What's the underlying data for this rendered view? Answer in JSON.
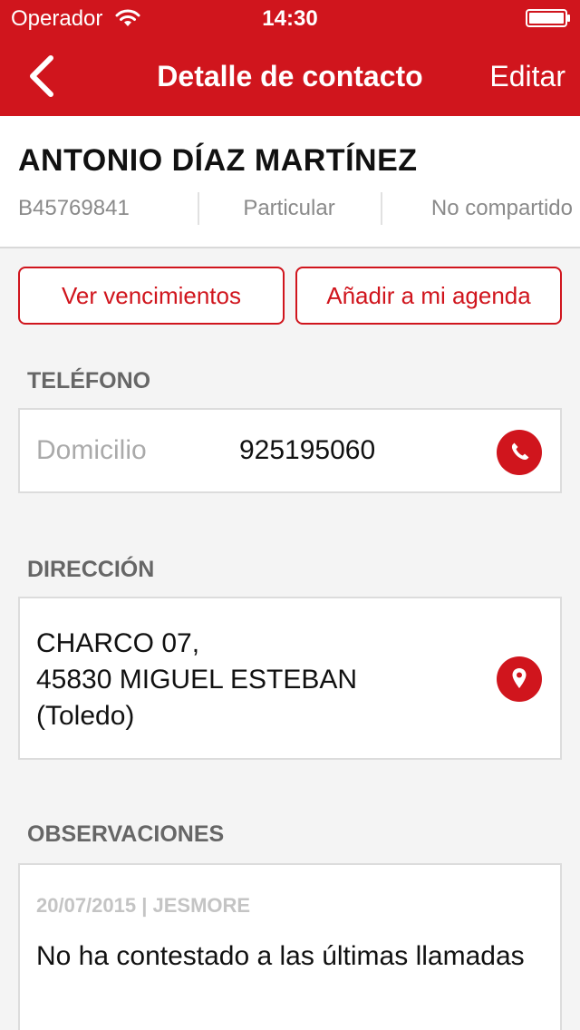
{
  "status_bar": {
    "carrier": "Operador",
    "time": "14:30"
  },
  "nav": {
    "title": "Detalle de contacto",
    "edit_label": "Editar"
  },
  "contact": {
    "name": "ANTONIO DÍAZ MARTÍNEZ",
    "id": "B45769841",
    "type": "Particular",
    "sharing": "No compartido"
  },
  "actions": {
    "vencimientos_label": "Ver vencimientos",
    "agenda_label": "Añadir a mi agenda"
  },
  "phone": {
    "section_title": "TELÉFONO",
    "type": "Domicilio",
    "number": "925195060"
  },
  "address": {
    "section_title": "DIRECCIÓN",
    "line1": "CHARCO 07,",
    "line2": "45830 MIGUEL ESTEBAN",
    "line3": "(Toledo)"
  },
  "observations": {
    "section_title": "OBSERVACIONES",
    "meta": "20/07/2015 | JESMORE",
    "text": "No ha contestado a las últimas llamadas"
  },
  "colors": {
    "accent": "#d0151d",
    "background": "#f4f4f4"
  },
  "icons": {
    "back": "chevron-left-icon",
    "wifi": "wifi-icon",
    "battery": "battery-icon",
    "call": "phone-icon",
    "map": "location-pin-icon"
  }
}
